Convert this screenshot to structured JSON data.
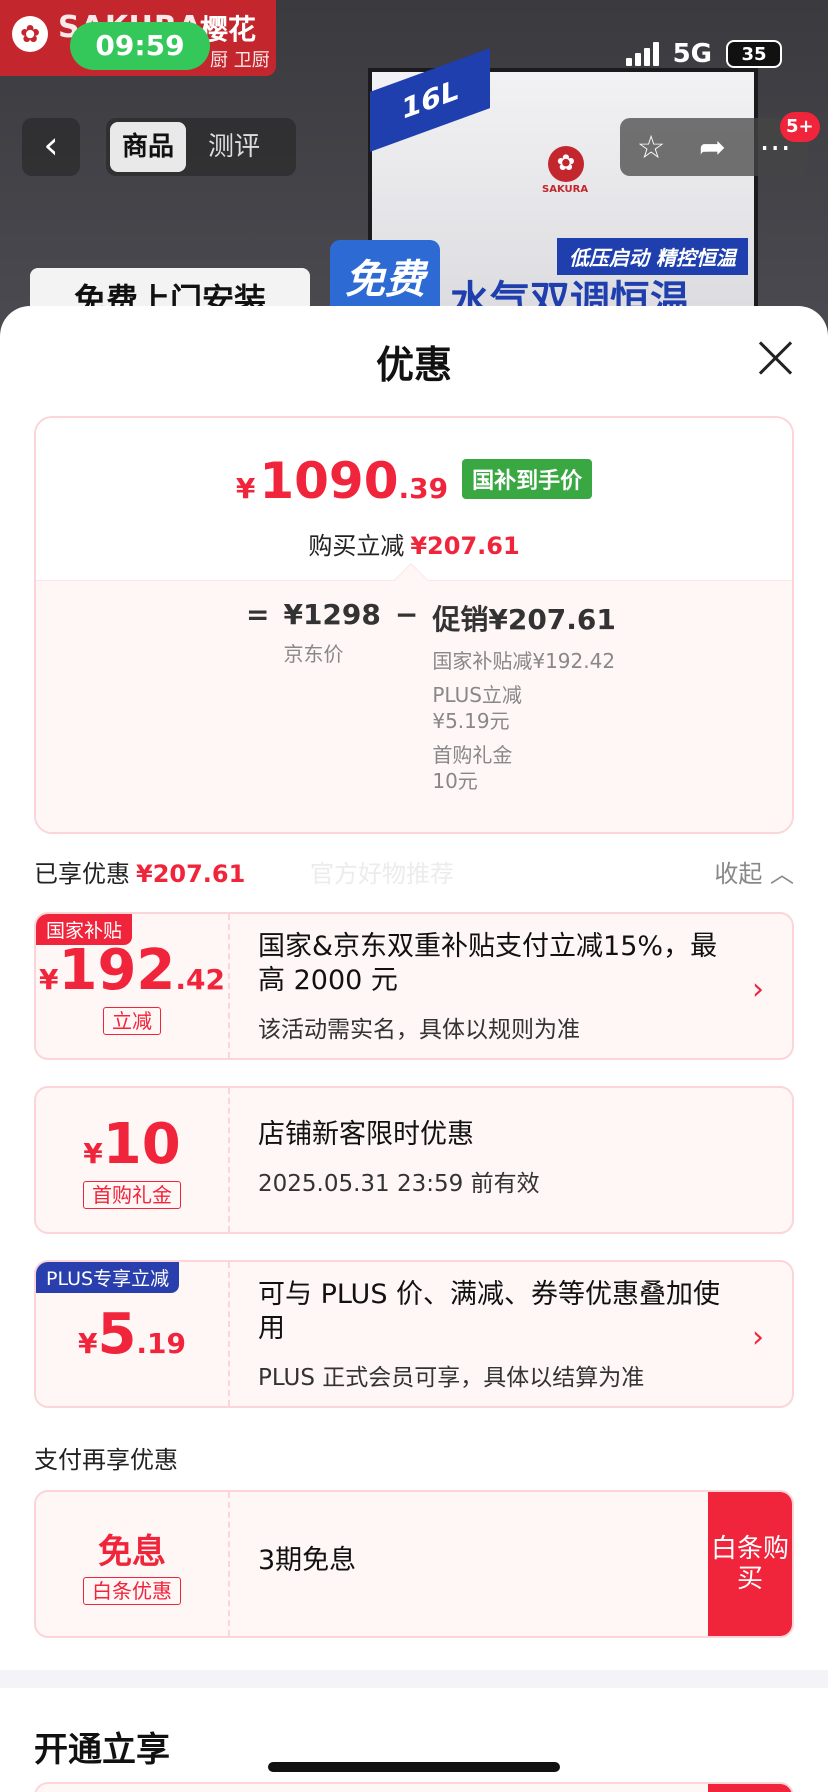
{
  "status_bar": {
    "time": "09:59",
    "network": "5G",
    "battery": "35"
  },
  "background": {
    "brand_en": "SAKURA",
    "brand_cn": "樱花",
    "brand_sub": "厨 卫厨",
    "product_capacity": "16L",
    "product_tagline": "低压启动 精控恒温",
    "free_badge": "免费",
    "banner_text": "水气双调恒温",
    "install_button": "免费上门安装"
  },
  "nav": {
    "back_icon": "‹",
    "tabs": [
      {
        "label": "商品",
        "active": true
      },
      {
        "label": "测评",
        "active": false
      }
    ],
    "cart_badge": "5+"
  },
  "sheet": {
    "title": "优惠",
    "price": {
      "currency": "¥",
      "integer": "1090",
      "decimal": ".39",
      "tag": "国补到手价",
      "reduce_label": "购买立减",
      "reduce_amount": "¥207.61"
    },
    "formula": {
      "equals": "=",
      "jd_price": "¥1298",
      "jd_price_label": "京东价",
      "minus": "−",
      "promo_label": "促销¥207.61",
      "details": [
        "国家补贴减¥192.42",
        "PLUS立减",
        "¥5.19元",
        "首购礼金",
        "10元"
      ]
    },
    "enjoyed": {
      "label": "已享优惠",
      "amount": "¥207.61",
      "ghost_text": "官方好物推荐",
      "collapse": "收起"
    },
    "coupons": [
      {
        "corner": "国家补贴",
        "corner_color": "#f0243a",
        "currency": "¥",
        "int": "192",
        "dec": ".42",
        "tag": "立减",
        "title": "国家&京东双重补贴支付立减15%，最高 2000 元",
        "desc": "该活动需实名，具体以规则为准",
        "has_arrow": true
      },
      {
        "corner": "",
        "currency": "¥",
        "int": "10",
        "dec": "",
        "tag": "首购礼金",
        "title": "店铺新客限时优惠",
        "desc": "2025.05.31 23:59 前有效",
        "has_arrow": false
      },
      {
        "corner": "PLUS专享立减",
        "corner_color": "#2a3fae",
        "currency": "¥",
        "int": "5",
        "dec": ".19",
        "tag": "",
        "title": "可与 PLUS 价、满减、券等优惠叠加使用",
        "desc": "PLUS 正式会员可享，具体以结算为准",
        "has_arrow": true
      }
    ],
    "pay_section_label": "支付再享优惠",
    "pay_coupon": {
      "title": "免息",
      "tag": "白条优惠",
      "desc": "3期免息",
      "button": "白条购买"
    },
    "open_title": "开通立享"
  }
}
